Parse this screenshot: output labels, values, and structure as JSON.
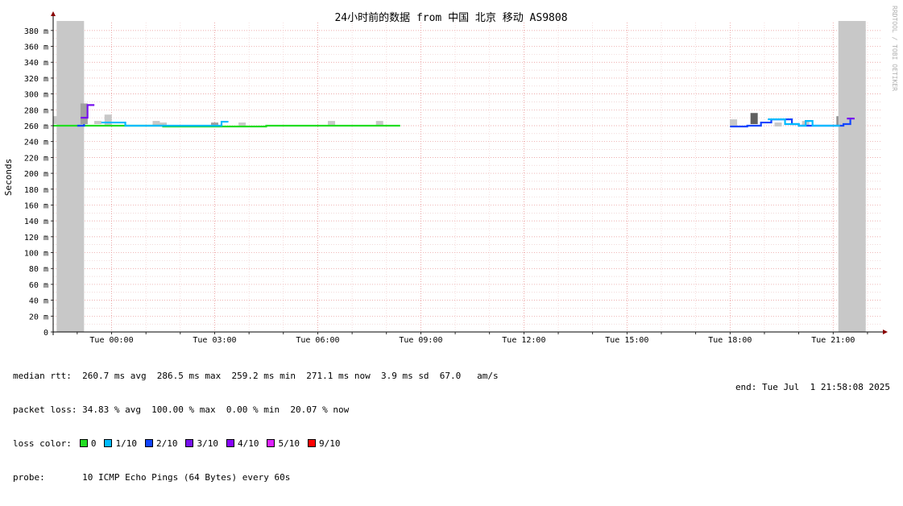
{
  "chart_data": {
    "type": "line",
    "title": "24小时前的数据 from 中国 北京 移动 AS9808",
    "ylabel": "Seconds",
    "watermark": "RRDTOOL / TOBI OETIKER",
    "ylim": [
      0,
      390
    ],
    "y_ticks": [
      {
        "value": 0,
        "label": "0"
      },
      {
        "value": 20,
        "label": "20 m"
      },
      {
        "value": 40,
        "label": "40 m"
      },
      {
        "value": 60,
        "label": "60 m"
      },
      {
        "value": 80,
        "label": "80 m"
      },
      {
        "value": 100,
        "label": "100 m"
      },
      {
        "value": 120,
        "label": "120 m"
      },
      {
        "value": 140,
        "label": "140 m"
      },
      {
        "value": 160,
        "label": "160 m"
      },
      {
        "value": 180,
        "label": "180 m"
      },
      {
        "value": 200,
        "label": "200 m"
      },
      {
        "value": 220,
        "label": "220 m"
      },
      {
        "value": 240,
        "label": "240 m"
      },
      {
        "value": 260,
        "label": "260 m"
      },
      {
        "value": 280,
        "label": "280 m"
      },
      {
        "value": 300,
        "label": "300 m"
      },
      {
        "value": 320,
        "label": "320 m"
      },
      {
        "value": 340,
        "label": "340 m"
      },
      {
        "value": 360,
        "label": "360 m"
      },
      {
        "value": 380,
        "label": "380 m"
      }
    ],
    "xlim": [
      -1.7,
      22.4
    ],
    "x_ticks": [
      {
        "value": 0,
        "label": "Tue 00:00"
      },
      {
        "value": 3,
        "label": "Tue 03:00"
      },
      {
        "value": 6,
        "label": "Tue 06:00"
      },
      {
        "value": 9,
        "label": "Tue 09:00"
      },
      {
        "value": 12,
        "label": "Tue 12:00"
      },
      {
        "value": 15,
        "label": "Tue 15:00"
      },
      {
        "value": 18,
        "label": "Tue 18:00"
      },
      {
        "value": 21,
        "label": "Tue 21:00"
      }
    ],
    "series": [
      {
        "color": "#22dd22",
        "points": [
          [
            -1.7,
            260
          ],
          [
            -1.3,
            260
          ],
          [
            -0.6,
            260
          ],
          [
            -0.1,
            260
          ],
          [
            0.6,
            260
          ],
          [
            1.5,
            259
          ],
          [
            3,
            259
          ],
          [
            4.5,
            260
          ],
          [
            6,
            260
          ],
          [
            7.5,
            260
          ],
          [
            8.4,
            260
          ]
        ]
      },
      {
        "color": "#00bbff",
        "points": [
          [
            -0.3,
            264
          ],
          [
            0.1,
            264
          ],
          [
            0.4,
            264
          ],
          [
            0.4,
            260
          ],
          [
            0.6,
            260
          ],
          [
            3.0,
            260
          ],
          [
            3.2,
            265
          ],
          [
            3.4,
            265
          ]
        ]
      },
      {
        "color": "#1144ff",
        "points": [
          [
            -1.0,
            260
          ],
          [
            -0.8,
            262
          ]
        ]
      },
      {
        "color": "#7711ee",
        "points": [
          [
            -0.9,
            270
          ],
          [
            -0.7,
            270
          ],
          [
            -0.7,
            286
          ],
          [
            -0.5,
            286
          ]
        ]
      },
      {
        "color": "#1144ff",
        "points": [
          [
            18.0,
            259
          ],
          [
            18.5,
            260
          ],
          [
            18.9,
            264
          ],
          [
            19.2,
            268
          ],
          [
            19.5,
            268
          ],
          [
            19.8,
            262
          ],
          [
            20.0,
            260
          ],
          [
            20.5,
            260
          ],
          [
            21.0,
            260
          ],
          [
            21.3,
            262
          ],
          [
            21.5,
            268
          ]
        ]
      },
      {
        "color": "#00bbff",
        "points": [
          [
            19.1,
            268
          ],
          [
            19.4,
            268
          ],
          [
            19.6,
            262
          ],
          [
            20.0,
            260
          ],
          [
            20.2,
            266
          ],
          [
            20.4,
            260
          ],
          [
            21.2,
            260
          ]
        ]
      },
      {
        "color": "#7711ee",
        "points": [
          [
            21.4,
            269
          ],
          [
            21.6,
            270
          ]
        ]
      }
    ],
    "smoke": [
      {
        "x": -1.6,
        "lo": 262,
        "hi": 272,
        "shade": "#c8c8c8"
      },
      {
        "x": -1.2,
        "lo": 0,
        "hi": 392,
        "shade": "#c8c8c8",
        "unknown": true
      },
      {
        "x": -0.4,
        "lo": 262,
        "hi": 266,
        "shade": "#c8c8c8"
      },
      {
        "x": -0.8,
        "lo": 262,
        "hi": 288,
        "shade": "#a0a0a0"
      },
      {
        "x": -0.1,
        "lo": 260,
        "hi": 274,
        "shade": "#c8c8c8"
      },
      {
        "x": 1.3,
        "lo": 259,
        "hi": 266,
        "shade": "#c8c8c8"
      },
      {
        "x": 1.5,
        "lo": 259,
        "hi": 264,
        "shade": "#c8c8c8"
      },
      {
        "x": 3.0,
        "lo": 259,
        "hi": 264,
        "shade": "#a0a0a0"
      },
      {
        "x": 3.8,
        "lo": 259,
        "hi": 264,
        "shade": "#c8c8c8"
      },
      {
        "x": 5.0,
        "lo": 259,
        "hi": 261,
        "shade": "#c8c8c8"
      },
      {
        "x": 6.4,
        "lo": 259,
        "hi": 266,
        "shade": "#c8c8c8"
      },
      {
        "x": 7.8,
        "lo": 259,
        "hi": 266,
        "shade": "#c8c8c8"
      },
      {
        "x": 18.1,
        "lo": 259,
        "hi": 268,
        "shade": "#c8c8c8"
      },
      {
        "x": 18.7,
        "lo": 262,
        "hi": 276,
        "shade": "#606060"
      },
      {
        "x": 19.4,
        "lo": 259,
        "hi": 264,
        "shade": "#c8c8c8"
      },
      {
        "x": 20.2,
        "lo": 259,
        "hi": 266,
        "shade": "#c8c8c8"
      },
      {
        "x": 21.2,
        "lo": 260,
        "hi": 272,
        "shade": "#909090"
      },
      {
        "x": 21.4,
        "lo": 260,
        "hi": 285,
        "shade": "#606060"
      },
      {
        "x": 21.55,
        "lo": 0,
        "hi": 392,
        "shade": "#c8c8c8",
        "unknown": true
      }
    ]
  },
  "legend": {
    "median_rtt": "median rtt:  260.7 ms avg  286.5 ms max  259.2 ms min  271.1 ms now  3.9 ms sd  67.0   am/s",
    "packet_loss": "packet loss: 34.83 % avg  100.00 % max  0.00 % min  20.07 % now",
    "loss_color_label": "loss color:",
    "loss_colors": [
      {
        "label": "0",
        "color": "#22dd22"
      },
      {
        "label": "1/10",
        "color": "#00bbff"
      },
      {
        "label": "2/10",
        "color": "#1144ff"
      },
      {
        "label": "3/10",
        "color": "#7711ee"
      },
      {
        "label": "4/10",
        "color": "#8800ff"
      },
      {
        "label": "5/10",
        "color": "#dd22ff"
      },
      {
        "label": "9/10",
        "color": "#ff0000"
      }
    ],
    "probe": "probe:       10 ICMP Echo Pings (64 Bytes) every 60s",
    "end": "end: Tue Jul  1 21:58:08 2025"
  }
}
